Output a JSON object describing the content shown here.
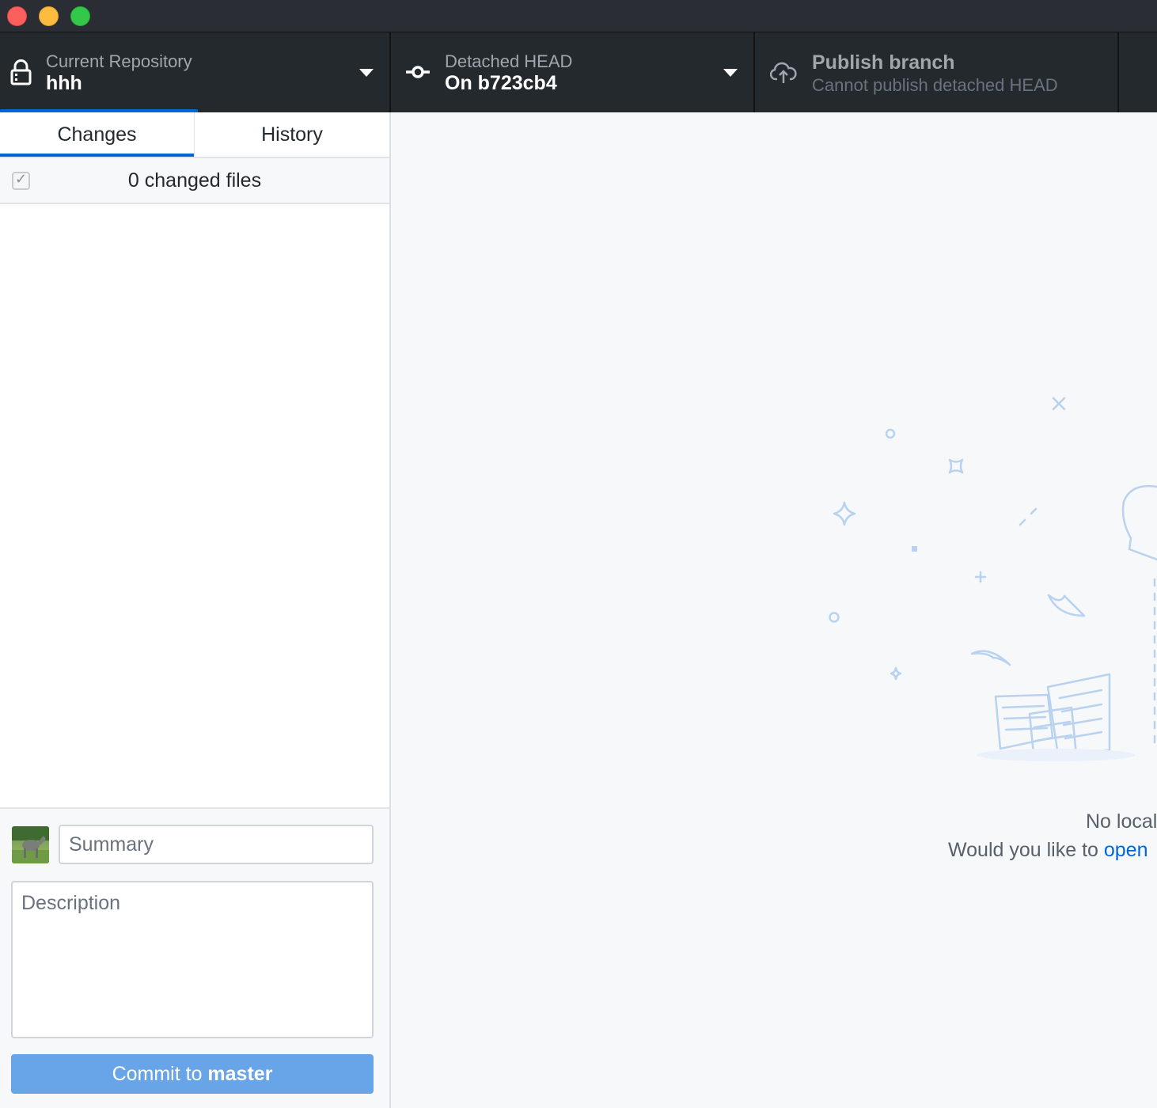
{
  "window": {
    "controls": [
      "close",
      "minimize",
      "maximize"
    ]
  },
  "toolbar": {
    "repository": {
      "label": "Current Repository",
      "value": "hhh",
      "icon": "lock-icon"
    },
    "branch": {
      "label": "Detached HEAD",
      "value": "On b723cb4",
      "icon": "git-commit-icon"
    },
    "publish": {
      "label": "Publish branch",
      "subtext": "Cannot publish detached HEAD",
      "icon": "cloud-upload-icon"
    }
  },
  "sidebar": {
    "tabs": [
      {
        "label": "Changes",
        "selected": true
      },
      {
        "label": "History",
        "selected": false
      }
    ],
    "changed_files": "0 changed files",
    "commit": {
      "summary_placeholder": "Summary",
      "description_placeholder": "Description",
      "button_prefix": "Commit to ",
      "button_branch": "master"
    }
  },
  "main": {
    "blank_slate": {
      "line1": "No local",
      "line2_prefix": "Would you like to ",
      "line2_link": "open"
    }
  },
  "colors": {
    "accent": "#0366d6",
    "toolbar_bg": "#24292e",
    "commit_button": "#68a4e8"
  }
}
